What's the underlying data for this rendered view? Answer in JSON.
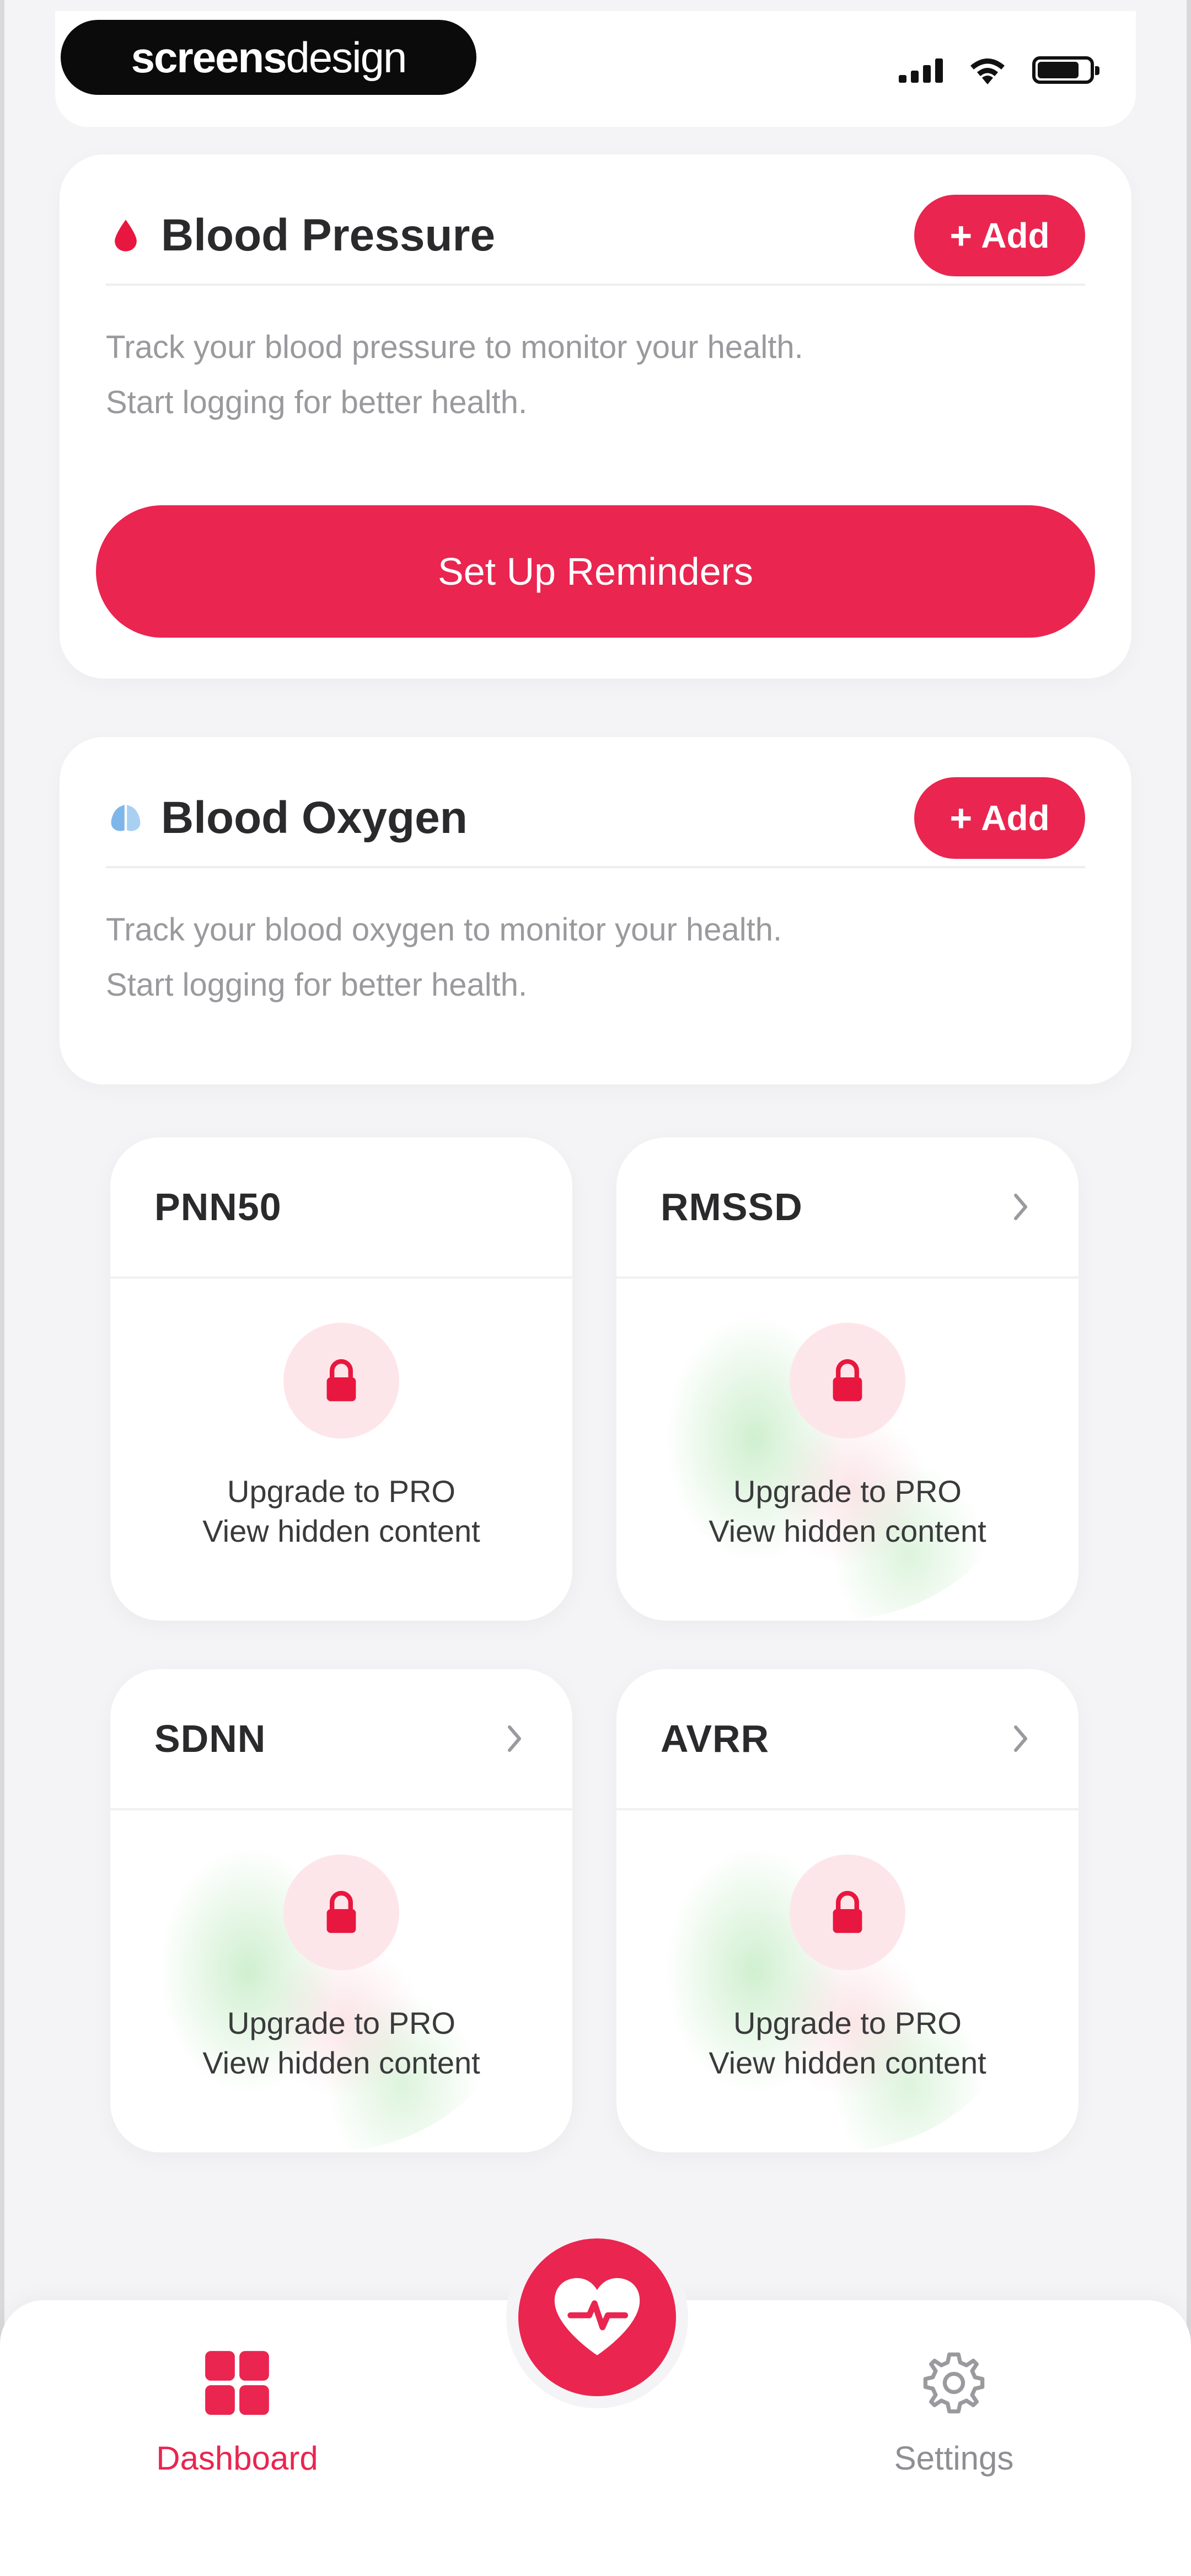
{
  "brand": {
    "part1": "screens",
    "part2": "design"
  },
  "colors": {
    "accent": "#ea2550",
    "background": "#f4f4f6",
    "card": "#ffffff",
    "muted": "#9a9a9e"
  },
  "blood_pressure": {
    "icon": "blood-drop-icon",
    "title": "Blood Pressure",
    "add_label": "Add",
    "description_line1": "Track your blood pressure to monitor your health.",
    "description_line2": "Start logging for better health.",
    "reminder_label": "Set Up Reminders"
  },
  "blood_oxygen": {
    "icon": "lungs-icon",
    "title": "Blood Oxygen",
    "add_label": "Add",
    "description_line1": "Track your blood oxygen to monitor your health.",
    "description_line2": "Start logging for better health."
  },
  "metrics": [
    {
      "title": "PNN50",
      "line1": "Upgrade to PRO",
      "line2": "View hidden content"
    },
    {
      "title": "RMSSD",
      "line1": "Upgrade to PRO",
      "line2": "View hidden content"
    },
    {
      "title": "SDNN",
      "line1": "Upgrade to PRO",
      "line2": "View hidden content"
    },
    {
      "title": "AVRR",
      "line1": "Upgrade to PRO",
      "line2": "View hidden content"
    }
  ],
  "nav": {
    "dashboard_label": "Dashboard",
    "settings_label": "Settings",
    "center_icon": "heart-pulse-icon"
  }
}
